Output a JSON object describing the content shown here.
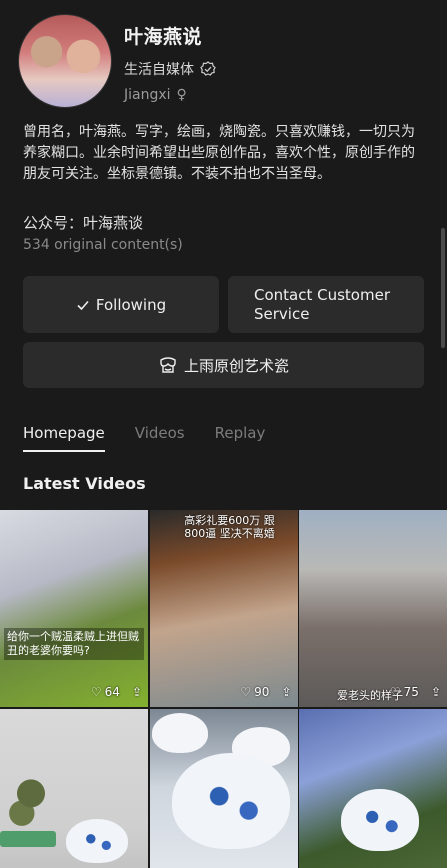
{
  "profile": {
    "name": "叶海燕说",
    "tag": "生活自媒体",
    "location": "Jiangxi",
    "gender_symbol": "♀"
  },
  "bio": "曾用名，叶海燕。写字，绘画，烧陶瓷。只喜欢赚钱，一切只为养家糊口。业余时间希望出些原创作品，喜欢个性，原创手作的朋友可关注。坐标景德镇。不装不拍也不当圣母。",
  "wechat": "公众号：叶海燕谈",
  "content_count": "534 original content(s)",
  "buttons": {
    "following": "Following",
    "contact": "Contact Customer Service",
    "shop": "上雨原创艺术瓷"
  },
  "tabs": [
    {
      "label": "Homepage",
      "active": true
    },
    {
      "label": "Videos",
      "active": false
    },
    {
      "label": "Replay",
      "active": false
    }
  ],
  "section_title": "Latest Videos",
  "videos": [
    {
      "overlay": "给你一个贼温柔贼上进但贼丑的老婆你要吗?",
      "likes": "64"
    },
    {
      "overlay": "高彩礼要600万 跟800逼 坚决不离婚",
      "likes": "90"
    },
    {
      "overlay": "爱老头的样子",
      "likes": "75"
    },
    {
      "overlay": "",
      "likes": ""
    },
    {
      "overlay": "",
      "likes": ""
    },
    {
      "overlay": "",
      "likes": ""
    }
  ],
  "colors": {
    "background": "#1a1a1a",
    "button": "#2b2b2b",
    "text_primary": "#f0f0f0",
    "text_secondary": "#8a8a8a"
  }
}
